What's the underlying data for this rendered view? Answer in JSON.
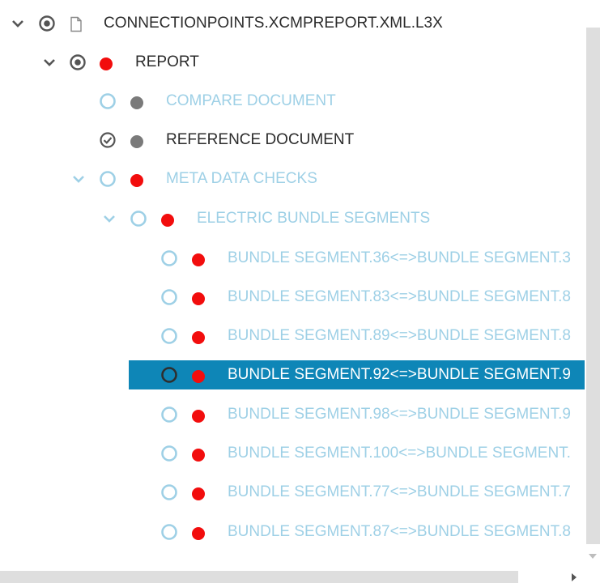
{
  "tree": {
    "root": {
      "label": "CONNECTIONPOINTS.XCMPREPORT.XML.L3X",
      "expanded": true,
      "state": "radio-selected",
      "icon": "document-icon"
    },
    "report": {
      "label": "REPORT",
      "expanded": true,
      "state": "radio-selected",
      "status": "red"
    },
    "compare_document": {
      "label": "COMPARE DOCUMENT",
      "state": "radio-empty",
      "status": "gray"
    },
    "reference_document": {
      "label": "REFERENCE DOCUMENT",
      "state": "check-circle",
      "status": "gray"
    },
    "meta_data_checks": {
      "label": "META DATA CHECKS",
      "expanded": true,
      "state": "radio-empty",
      "status": "red"
    },
    "electric_bundle_segments": {
      "label": "ELECTRIC BUNDLE SEGMENTS",
      "expanded": true,
      "state": "radio-empty",
      "status": "red"
    },
    "segments": [
      {
        "label": "BUNDLE SEGMENT.36<=>BUNDLE SEGMENT.3",
        "selected": false
      },
      {
        "label": "BUNDLE SEGMENT.83<=>BUNDLE SEGMENT.8",
        "selected": false
      },
      {
        "label": "BUNDLE SEGMENT.89<=>BUNDLE SEGMENT.8",
        "selected": false
      },
      {
        "label": "BUNDLE SEGMENT.92<=>BUNDLE SEGMENT.9",
        "selected": true
      },
      {
        "label": "BUNDLE SEGMENT.98<=>BUNDLE SEGMENT.9",
        "selected": false
      },
      {
        "label": "BUNDLE SEGMENT.100<=>BUNDLE SEGMENT.",
        "selected": false
      },
      {
        "label": "BUNDLE SEGMENT.77<=>BUNDLE SEGMENT.7",
        "selected": false
      },
      {
        "label": "BUNDLE SEGMENT.87<=>BUNDLE SEGMENT.8",
        "selected": false
      }
    ]
  },
  "colors": {
    "selection": "#0e86b7",
    "status_red": "#f20d0d",
    "status_gray": "#7a7a7a",
    "radio_light": "#9ed0e6",
    "radio_dark": "#555555",
    "text_dark": "#2b2b2b",
    "text_light": "#9ed0e6"
  }
}
